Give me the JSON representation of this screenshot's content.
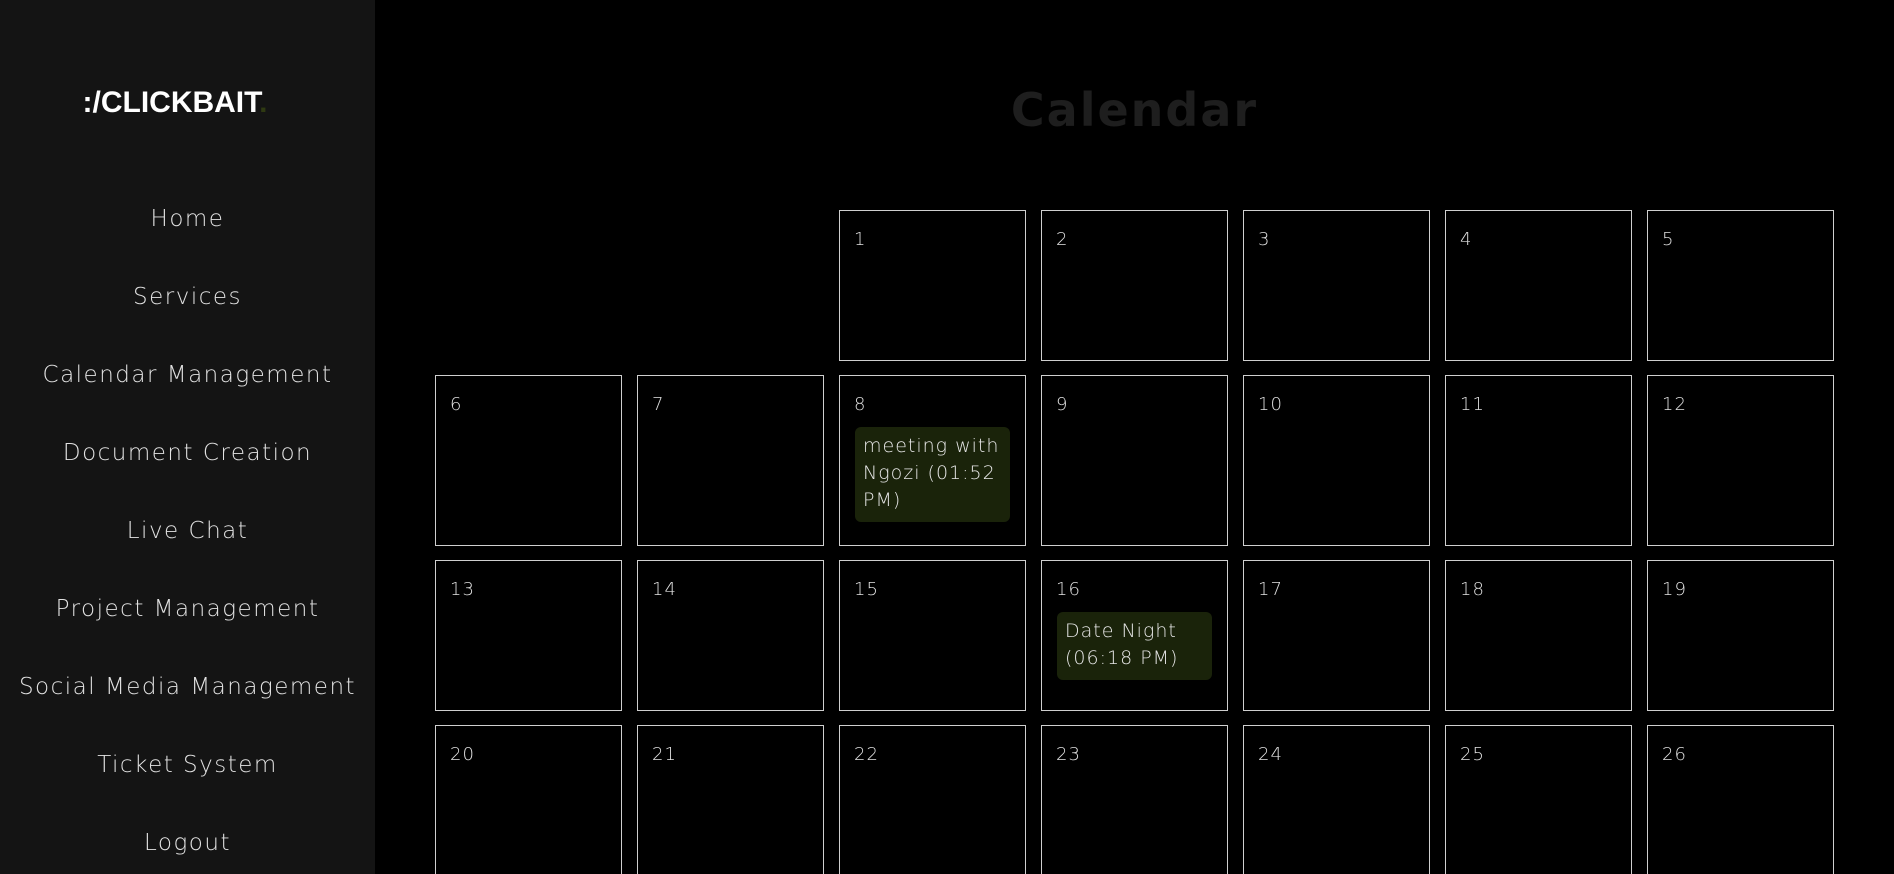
{
  "sidebar": {
    "logo": {
      "text": ":/CLICKBAIT",
      "dot": "."
    },
    "nav_items": [
      {
        "id": "home",
        "label": "Home"
      },
      {
        "id": "services",
        "label": "Services"
      },
      {
        "id": "calendar-management",
        "label": "Calendar Management"
      },
      {
        "id": "document-creation",
        "label": "Document Creation"
      },
      {
        "id": "live-chat",
        "label": "Live Chat"
      },
      {
        "id": "project-management",
        "label": "Project Management"
      },
      {
        "id": "social-media-management",
        "label": "Social Media Management"
      },
      {
        "id": "ticket-system",
        "label": "Ticket System"
      },
      {
        "id": "logout",
        "label": "Logout"
      }
    ]
  },
  "main": {
    "title": "Calendar",
    "calendar": {
      "leading_blanks": 2,
      "days": [
        {
          "day": "1"
        },
        {
          "day": "2"
        },
        {
          "day": "3"
        },
        {
          "day": "4"
        },
        {
          "day": "5"
        },
        {
          "day": "6"
        },
        {
          "day": "7"
        },
        {
          "day": "8",
          "event": "meeting with Ngozi (01:52 PM)"
        },
        {
          "day": "9"
        },
        {
          "day": "10"
        },
        {
          "day": "11"
        },
        {
          "day": "12"
        },
        {
          "day": "13"
        },
        {
          "day": "14"
        },
        {
          "day": "15"
        },
        {
          "day": "16",
          "event": "Date Night (06:18 PM)"
        },
        {
          "day": "17"
        },
        {
          "day": "18"
        },
        {
          "day": "19"
        },
        {
          "day": "20"
        },
        {
          "day": "21"
        },
        {
          "day": "22"
        },
        {
          "day": "23"
        },
        {
          "day": "24"
        },
        {
          "day": "25"
        },
        {
          "day": "26"
        }
      ]
    }
  },
  "colors": {
    "sidebar_bg": "#141414",
    "page_bg": "#000000",
    "event_bg": "#1a230a",
    "cell_border": "#cfcfcf",
    "logo_dot": "#2f3a12"
  }
}
